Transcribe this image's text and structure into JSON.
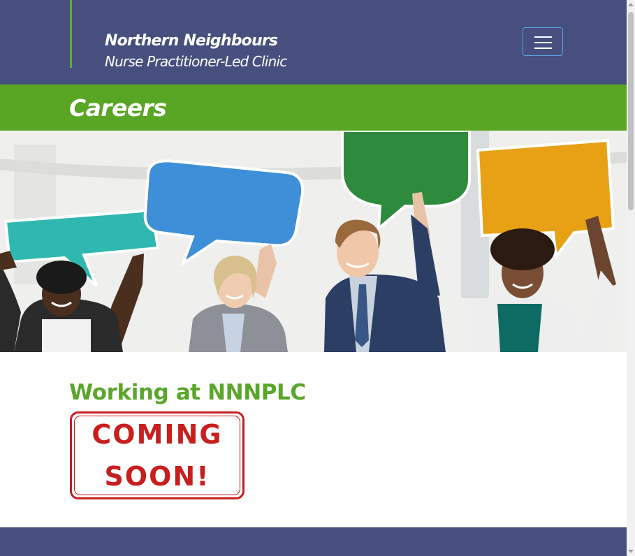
{
  "header": {
    "brand_line1": "Northern Neighbours",
    "brand_line2": "Nurse Practitioner-Led Clinic",
    "menu_icon": "hamburger-menu-icon",
    "background_color": "#474f7f",
    "accent_color": "#5bb02a"
  },
  "banner": {
    "title": "Careers",
    "background_color": "#58a624"
  },
  "hero": {
    "image": "people-holding-speech-bubbles-photo"
  },
  "content": {
    "section_title": "Working at NNNPLC",
    "coming_soon_line1": "COMING",
    "coming_soon_line2": "SOON!",
    "title_color": "#5aa62a",
    "stamp_color": "#c81e1e"
  },
  "footer": {
    "background_color": "#474f7f"
  }
}
